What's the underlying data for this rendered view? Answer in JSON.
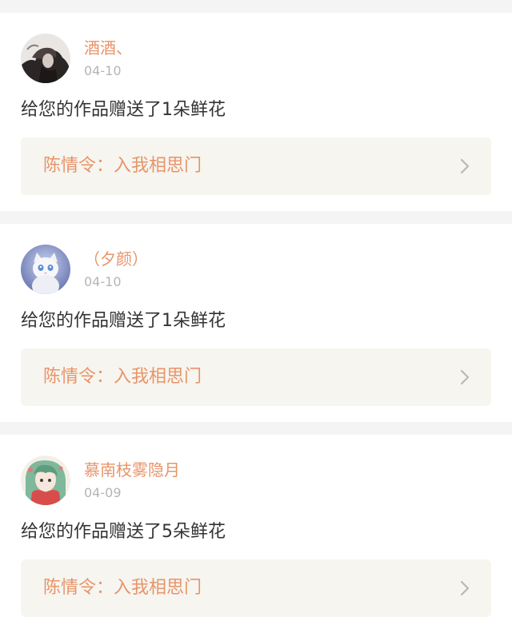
{
  "colors": {
    "accent": "#e8946a",
    "text": "#333333",
    "muted": "#b5b5b5",
    "card_background": "#ffffff",
    "page_background": "#f4f4f4",
    "link_background": "#f6f5ef"
  },
  "notifications": [
    {
      "username": "酒酒、",
      "date": "04-10",
      "message": "给您的作品赠送了1朵鲜花",
      "work_title": "陈情令：入我相思门",
      "avatar": "avatar-dark-figure",
      "arrow_icon": "chevron-right-icon"
    },
    {
      "username": "（夕颜）",
      "date": "04-10",
      "message": "给您的作品赠送了1朵鲜花",
      "work_title": "陈情令：入我相思门",
      "avatar": "avatar-white-cat",
      "arrow_icon": "chevron-right-icon"
    },
    {
      "username": "慕南枝雾隐月",
      "date": "04-09",
      "message": "给您的作品赠送了5朵鲜花",
      "work_title": "陈情令：入我相思门",
      "avatar": "avatar-anime-girl",
      "arrow_icon": "chevron-right-icon"
    }
  ]
}
